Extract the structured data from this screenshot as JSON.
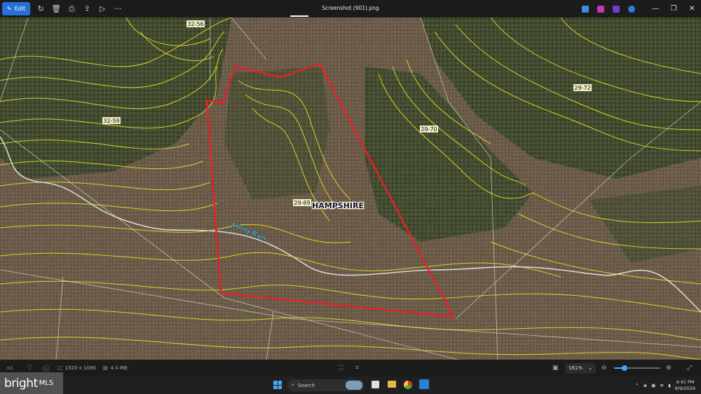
{
  "toolbar": {
    "edit_label": "Edit",
    "window_title": "Screenshot (901).png",
    "more_label": "···"
  },
  "map": {
    "parcels": [
      {
        "id": "p1",
        "label": "32-56"
      },
      {
        "id": "p2",
        "label": "32-59"
      },
      {
        "id": "p3",
        "label": "29-70"
      },
      {
        "id": "p4",
        "label": "29-72"
      },
      {
        "id": "p5",
        "label": "29-69"
      }
    ],
    "county_label": "HAMPSHIRE",
    "stream_label": "Long Run",
    "boundary_color": "#e8202a",
    "contour_color": "#e6e02a",
    "stream_color": "#d8d8d8"
  },
  "status": {
    "dimensions": "1920 x 1080",
    "filesize": "4.4 MB",
    "zoom": "161%"
  },
  "taskbar": {
    "search_placeholder": "Search",
    "time": "4:41 PM",
    "date": "8/9/2026"
  },
  "watermark": {
    "brand": "bright",
    "suffix": "MLS"
  }
}
